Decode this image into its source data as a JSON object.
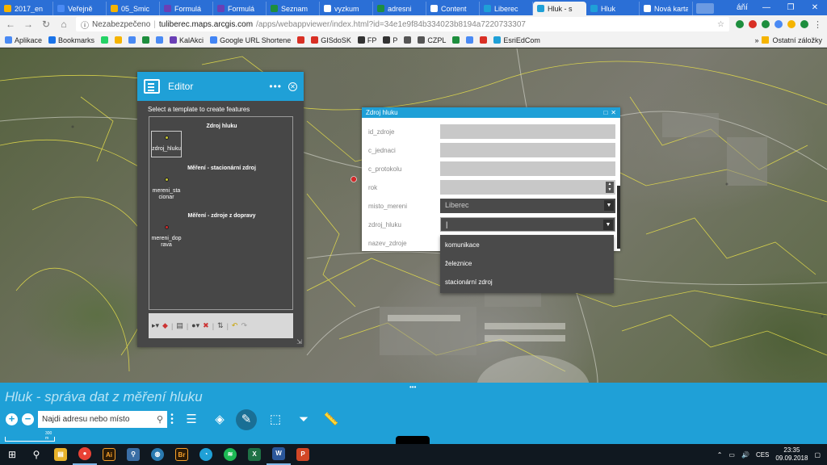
{
  "browser": {
    "tabs": [
      {
        "label": "2017_en",
        "color": "#f5b400",
        "active": false
      },
      {
        "label": "Veřejně",
        "color": "#4a8af4",
        "active": false
      },
      {
        "label": "05_Smic",
        "color": "#f5b400",
        "active": false
      },
      {
        "label": "Formulá",
        "color": "#6a3fb5",
        "active": false
      },
      {
        "label": "Formulá",
        "color": "#6a3fb5",
        "active": false
      },
      {
        "label": "Seznam",
        "color": "#1e8e3e",
        "active": false
      },
      {
        "label": "vyzkum",
        "color": "#ffffff",
        "active": false
      },
      {
        "label": "adresni",
        "color": "#1e8e3e",
        "active": false
      },
      {
        "label": "Content",
        "color": "#ffffff",
        "active": false
      },
      {
        "label": "Liberec",
        "color": "#1fa0d7",
        "active": false
      },
      {
        "label": "Hluk - s",
        "color": "#1fa0d7",
        "active": true
      },
      {
        "label": "Hluk",
        "color": "#1fa0d7",
        "active": false
      },
      {
        "label": "Nová karta",
        "color": "#ffffff",
        "active": false
      }
    ],
    "profile": "áňí",
    "insecure_label": "Nezabezpečeno",
    "url_host": "tuliberec.maps.arcgis.com",
    "url_path": "/apps/webappviewer/index.html?id=34e1e9f84b334023b8194a7220733307",
    "bookmarks": [
      {
        "label": "Aplikace",
        "color": "#4a8af4"
      },
      {
        "label": "Bookmarks",
        "color": "#1a73e8"
      },
      {
        "label": "",
        "color": "#25d366"
      },
      {
        "label": "",
        "color": "#f5b400"
      },
      {
        "label": "",
        "color": "#4a8af4"
      },
      {
        "label": "",
        "color": "#1e8e3e"
      },
      {
        "label": "",
        "color": "#4a8af4"
      },
      {
        "label": "KalAkci",
        "color": "#6a3fb5"
      },
      {
        "label": "Google URL Shortene",
        "color": "#4285f4"
      },
      {
        "label": "",
        "color": "#d93025"
      },
      {
        "label": "GISdoSK",
        "color": "#d93025"
      },
      {
        "label": "FP",
        "color": "#333333"
      },
      {
        "label": "P",
        "color": "#333333"
      },
      {
        "label": "",
        "color": "#555555"
      },
      {
        "label": "CZPL",
        "color": "#555555"
      },
      {
        "label": "",
        "color": "#1e8e3e"
      },
      {
        "label": "",
        "color": "#4a8af4"
      },
      {
        "label": "",
        "color": "#d93025"
      },
      {
        "label": "EsriEdCom",
        "color": "#1fa0d7"
      }
    ],
    "bookmarks_more": "»",
    "other_bookmarks": "Ostatní záložky"
  },
  "editor": {
    "title": "Editor",
    "hint": "Select a template to create features",
    "groups": [
      {
        "title": "Zdroj hluku",
        "item": "zdroj_hluku",
        "dot_color": "#c8c830"
      },
      {
        "title": "Měření - stacionární zdroj",
        "item": "mereni_stacionar",
        "dot_color": "#c8c830"
      },
      {
        "title": "Měření - zdroje z dopravy",
        "item": "mereni_doprava",
        "dot_color": "#d02a2a"
      }
    ],
    "item_labels": [
      "zdroj_hluku",
      "mereni_sta",
      "cionar",
      "mereni_dop",
      "rava"
    ]
  },
  "attributes": {
    "title": "Zdroj hluku",
    "fields": [
      {
        "label": "id_zdroje",
        "value": ""
      },
      {
        "label": "c_jednaci",
        "value": ""
      },
      {
        "label": "c_protokolu",
        "value": ""
      },
      {
        "label": "rok",
        "value": ""
      },
      {
        "label": "misto_mereni",
        "value": "Liberec"
      },
      {
        "label": "zdroj_hluku",
        "value": "|"
      },
      {
        "label": "nazev_zdroje",
        "value": ""
      }
    ],
    "dropdown_options": [
      "komunikace",
      "železnice",
      "stacionární zdroj"
    ]
  },
  "app": {
    "title": "Hluk - správa dat z měření hluku",
    "search_placeholder": "Najdi adresu nebo místo",
    "scale_label": "300 m"
  },
  "taskbar": {
    "language": "CES",
    "time": "23:35",
    "date": "09.09.2018"
  }
}
